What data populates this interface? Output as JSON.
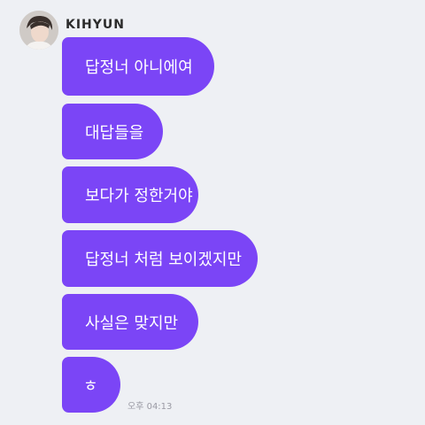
{
  "chat": {
    "sender": {
      "name": "KIHYUN",
      "avatar_icon": "profile-photo"
    },
    "bubble_color": "#7b45f6",
    "messages": [
      {
        "text": "답정너 아니에여"
      },
      {
        "text": "대답들을"
      },
      {
        "text": "보다가 정한거야"
      },
      {
        "text": "답정너 처럼 보이겠지만"
      },
      {
        "text": "사실은 맞지만"
      },
      {
        "text": "ㅎ"
      }
    ],
    "timestamp": "오후 04:13"
  }
}
